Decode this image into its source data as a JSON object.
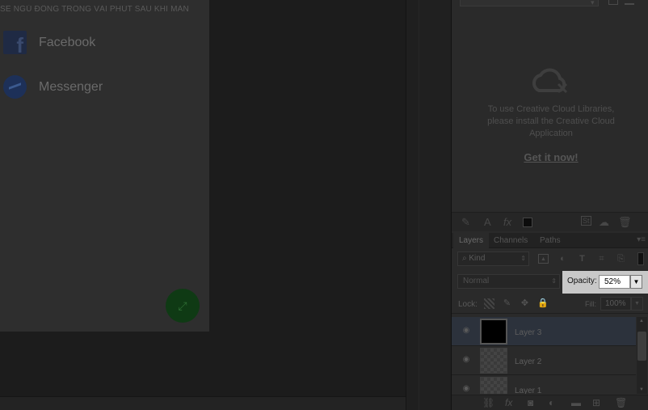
{
  "document": {
    "header_text": "SẼ NGỦ ĐÔNG TRONG VÀI PHÚT SAU KHI MÀN",
    "share_items": [
      {
        "label": "Facebook",
        "icon": "facebook-icon"
      },
      {
        "label": "Messenger",
        "icon": "messenger-icon"
      }
    ],
    "fab_icon": "share-icon"
  },
  "libraries": {
    "message": "To use Creative Cloud Libraries, please install the Creative Cloud Application",
    "link": "Get it now!"
  },
  "layers_panel": {
    "tabs": [
      {
        "label": "Layers",
        "active": true
      },
      {
        "label": "Channels",
        "active": false
      },
      {
        "label": "Paths",
        "active": false
      }
    ],
    "filter_kind": "Kind",
    "blend_mode": "Normal",
    "opacity_label": "Opacity:",
    "opacity_value": "52%",
    "lock_label": "Lock:",
    "fill_label": "Fill:",
    "fill_value": "100%",
    "layers": [
      {
        "name": "Layer 3",
        "selected": true,
        "thumb": "black"
      },
      {
        "name": "Layer 2",
        "selected": false,
        "thumb": "checker"
      },
      {
        "name": "Layer 1",
        "selected": false,
        "thumb": "checker"
      }
    ]
  },
  "colors": {
    "selected_layer_bg": "#2c323c",
    "opacity_highlight": "#c8c8c8"
  }
}
